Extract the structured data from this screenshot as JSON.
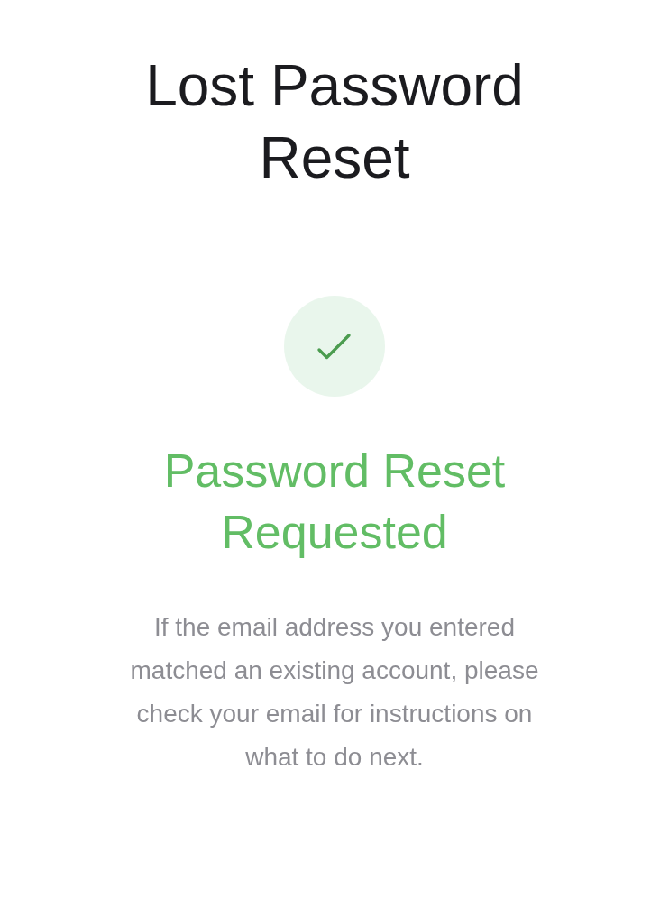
{
  "title": "Lost Password Reset",
  "confirmation": {
    "heading": "Password Reset Requested",
    "message": "If the email address you entered matched an existing account, please check your email for instructions on what to do next."
  }
}
